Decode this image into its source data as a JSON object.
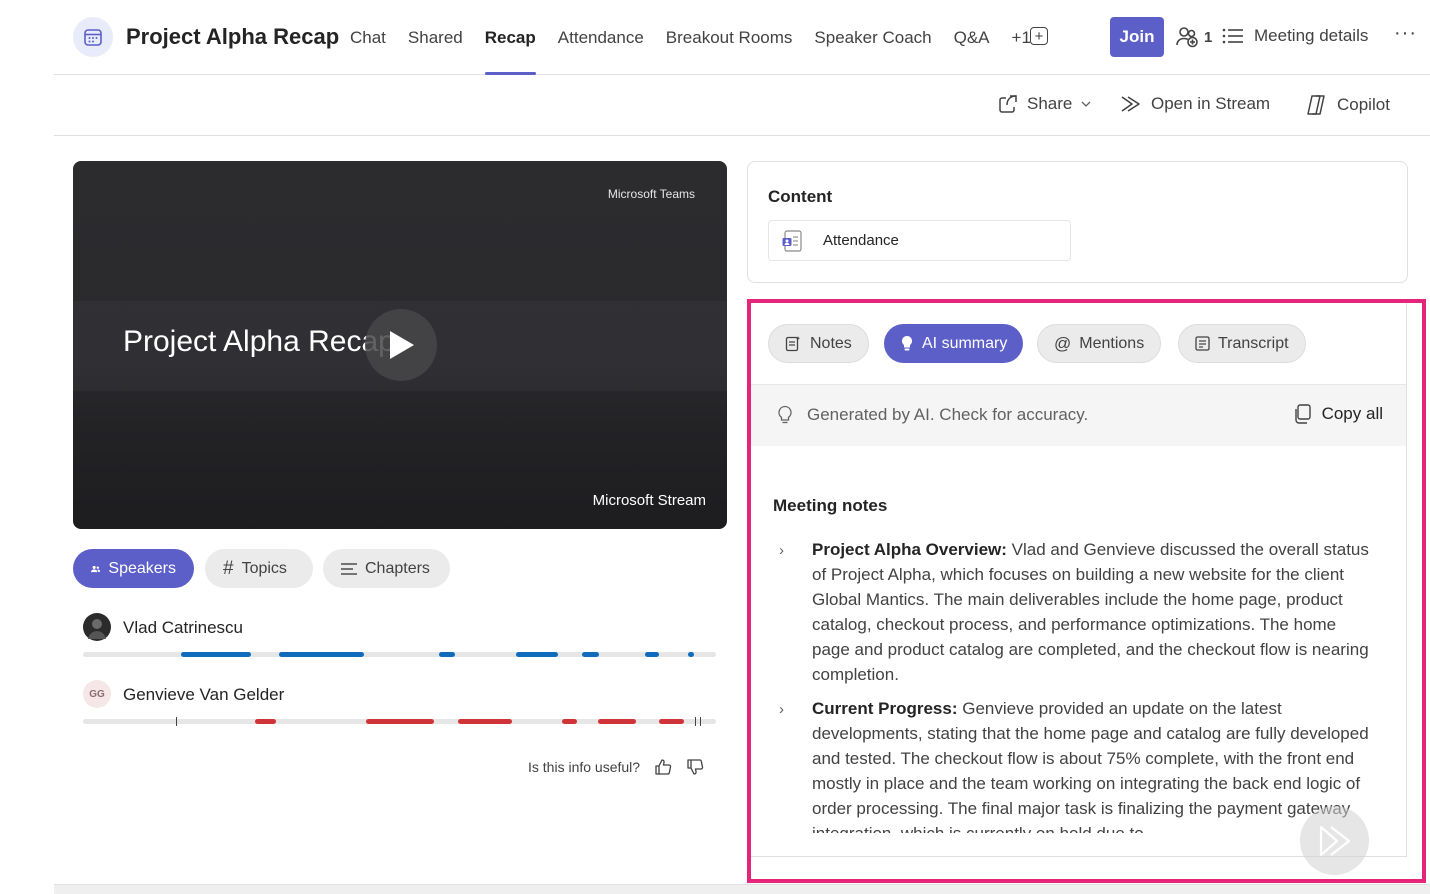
{
  "header": {
    "title": "Project Alpha Recap",
    "tabs": [
      {
        "label": "Chat",
        "active": false
      },
      {
        "label": "Shared",
        "active": false
      },
      {
        "label": "Recap",
        "active": true
      },
      {
        "label": "Attendance",
        "active": false
      },
      {
        "label": "Breakout Rooms",
        "active": false
      },
      {
        "label": "Speaker Coach",
        "active": false
      },
      {
        "label": "Q&A",
        "active": false
      },
      {
        "label": "+1",
        "active": false
      }
    ],
    "join_label": "Join",
    "participant_count": "1",
    "meeting_details_label": "Meeting details",
    "more_label": "···"
  },
  "toolbar": {
    "share_label": "Share",
    "open_stream_label": "Open in Stream",
    "copilot_label": "Copilot"
  },
  "video": {
    "top_label": "Microsoft Teams",
    "title": "Project Alpha Recap",
    "bottom_label": "Microsoft Stream"
  },
  "speaker_tabs": {
    "speakers": "Speakers",
    "topics": "Topics",
    "chapters": "Chapters"
  },
  "speakers": [
    {
      "name": "Vlad Catrinescu",
      "initials": "",
      "color": "#0f6cbd",
      "segments": [
        [
          0.155,
          0.265
        ],
        [
          0.31,
          0.444
        ],
        [
          0.563,
          0.588
        ],
        [
          0.684,
          0.75
        ],
        [
          0.788,
          0.815
        ],
        [
          0.888,
          0.91
        ],
        [
          0.956,
          0.966
        ]
      ]
    },
    {
      "name": "Genvieve Van Gelder",
      "initials": "GG",
      "color": "#d13438",
      "segments": [
        [
          0.272,
          0.305
        ],
        [
          0.447,
          0.555
        ],
        [
          0.593,
          0.678
        ],
        [
          0.757,
          0.78
        ],
        [
          0.814,
          0.873
        ],
        [
          0.91,
          0.95
        ]
      ]
    }
  ],
  "feedback": {
    "question": "Is this info useful?"
  },
  "content": {
    "heading": "Content",
    "file_label": "Attendance"
  },
  "recap": {
    "tabs": [
      {
        "label": "Notes",
        "active": false
      },
      {
        "label": "AI summary",
        "active": true
      },
      {
        "label": "Mentions",
        "active": false
      },
      {
        "label": "Transcript",
        "active": false
      }
    ],
    "ai_note": "Generated by AI. Check for accuracy.",
    "copy_all": "Copy all",
    "notes_heading": "Meeting notes",
    "notes": [
      {
        "title": "Project Alpha Overview:",
        "text": "Vlad and Genvieve discussed the overall status of Project Alpha, which focuses on building a new website for the client Global Mantics. The main deliverables include the home page, product catalog, checkout process, and performance optimizations. The home page and product catalog are completed, and the checkout flow is nearing completion."
      },
      {
        "title": "Current Progress:",
        "text": "Genvieve provided an update on the latest developments, stating that the home page and catalog are fully developed and tested. The checkout flow is about 75% complete, with the front end mostly in place and the team working on integrating the back end logic of order processing. The final major task is finalizing the payment gateway integration, which is currently on hold due to"
      }
    ]
  },
  "colors": {
    "accent": "#5b5fc7",
    "highlight_border": "#e5257a",
    "speaker_blue": "#0f6cbd",
    "speaker_red": "#d13438"
  }
}
